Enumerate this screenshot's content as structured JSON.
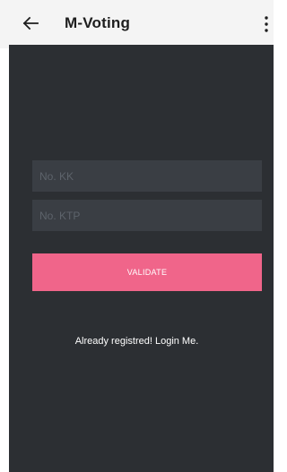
{
  "app_bar": {
    "title": "M-Voting",
    "back_icon": "arrow-left-icon",
    "menu_icon": "more-vertical-icon",
    "background": "#f4f4f4"
  },
  "form": {
    "kk_placeholder": "No. KK",
    "ktp_placeholder": "No. KTP",
    "validate_label": "VALIDATE",
    "login_link": "Already registred! Login Me."
  },
  "colors": {
    "content_background": "#2c2f33",
    "field_background": "#3a3e44",
    "accent": "#f0658a"
  }
}
